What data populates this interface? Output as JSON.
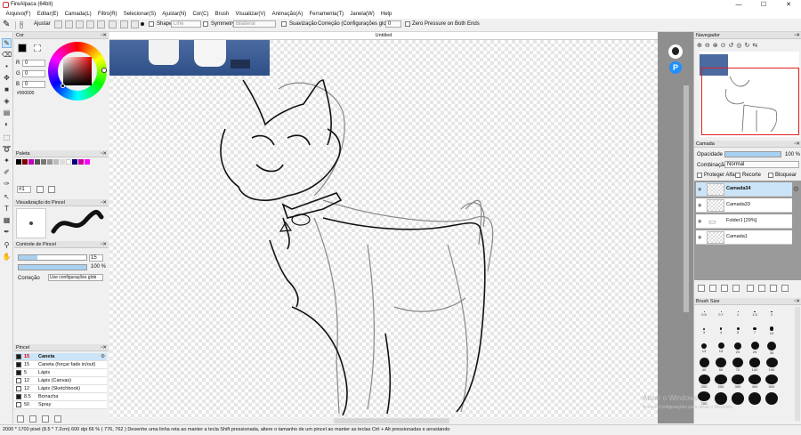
{
  "window": {
    "title": "FireAlpaca (64bit)",
    "controls": [
      "—",
      "☐",
      "✕"
    ]
  },
  "menu": [
    "Arquivo(F)",
    "Editar(E)",
    "Camada(L)",
    "Filtro(R)",
    "Selecionar(S)",
    "Ajustar(N)",
    "Cor(C)",
    "Brush",
    "Visualizar(V)",
    "Animação(A)",
    "Ferramenta(T)",
    "Janela(W)",
    "Help"
  ],
  "tool_options": {
    "fit_label": "Ajustar",
    "shape_label": "Shape",
    "shape_value": "Line",
    "symmetry_label": "Symmetry",
    "symmetry_value": "Bilateral",
    "stabilizer_label": "Suavização",
    "correction_label": "Correção (Configurações globais)",
    "correction_value": "0",
    "zero_pressure_label": "Zero Pressure on Both Ends"
  },
  "document": {
    "tab_title": "Untitled"
  },
  "color_panel": {
    "title": "Cor",
    "r": "0",
    "g": "0",
    "b": "0",
    "hex": "#000000",
    "r_label": "R",
    "g_label": "G",
    "b_label": "B"
  },
  "palette_panel": {
    "title": "Paleta",
    "colors": [
      "#000000",
      "#7f0000",
      "#c000c0",
      "#555555",
      "#777777",
      "#999999",
      "#bbbbbb",
      "#dddddd",
      "#ffffff",
      "#000080",
      "#cc0099",
      "#ff00ff"
    ],
    "selector": "#1"
  },
  "brush_preview_panel": {
    "title": "Visualização do Pincel"
  },
  "brush_control_panel": {
    "title": "Controle de Pincel",
    "size_value": "15",
    "opacity_value": "100 %",
    "correction_label": "Correção",
    "correction_value": "Use configurações glob",
    "size_fill": 0.28,
    "opacity_fill": 1.0
  },
  "brush_panel": {
    "title": "Pincel",
    "items": [
      {
        "size": "15",
        "name": "Caneta",
        "selected": true,
        "swatch": "#1a1a1a"
      },
      {
        "size": "15",
        "name": "Caneta (forçar fade in/out)",
        "selected": false,
        "swatch": "#1a1a1a"
      },
      {
        "size": "5",
        "name": "Lápis",
        "selected": false,
        "swatch": "#1a1a1a"
      },
      {
        "size": "12",
        "name": "Lápis (Canvas)",
        "selected": false,
        "swatch": "#ffffff"
      },
      {
        "size": "12",
        "name": "Lápis (Sketchbook)",
        "selected": false,
        "swatch": "#ffffff"
      },
      {
        "size": "8.5",
        "name": "Borracha",
        "selected": false,
        "swatch": "#1a1a1a"
      },
      {
        "size": "50",
        "name": "Spray",
        "selected": false,
        "swatch": "#ffffff"
      }
    ]
  },
  "navigator_panel": {
    "title": "Navegador"
  },
  "layer_panel": {
    "title": "Camada",
    "opacity_label": "Opacidade",
    "opacity_value": "100 %",
    "blend_label": "Combinação",
    "blend_value": "Normal",
    "protect_alpha": "Proteger Alfa",
    "clipping": "Recorte",
    "lock": "Bloquear",
    "layers": [
      {
        "name": "Camada34",
        "selected": true
      },
      {
        "name": "Camada33",
        "selected": false
      },
      {
        "name": "Folder1 [29%]",
        "selected": false
      },
      {
        "name": "Camada1",
        "selected": false
      }
    ]
  },
  "brush_size_panel": {
    "title": "Brush Size",
    "sizes": [
      "0.5",
      "0.7",
      "1",
      "1.5",
      "2",
      "3",
      "4",
      "5",
      "7",
      "10",
      "13",
      "15",
      "20",
      "25",
      "30",
      "40",
      "50",
      "70",
      "100",
      "150",
      "200",
      "250",
      "300",
      "400",
      "500",
      "700",
      "",
      "",
      "",
      ""
    ]
  },
  "status": {
    "text": "2000 * 1700 pixel  (8.5 * 7.2cm)  600 dpi  66 %  ( 776, 762 )  Desenhe uma linha reta ao manter a tecla Shift pressionada, altere o tamanho de um pincel ao manter as teclas Ctrl + Alt pressionadas e arrastando"
  },
  "watermark": {
    "line1": "Ativar o Windows",
    "line2": "Acesse Configurações para ativar o Windows."
  },
  "colors": {
    "accent": "#cce4f7",
    "selection_border": "#7eb4ea",
    "nav_frame": "#e02020",
    "gray_area": "#8f8f8f"
  }
}
